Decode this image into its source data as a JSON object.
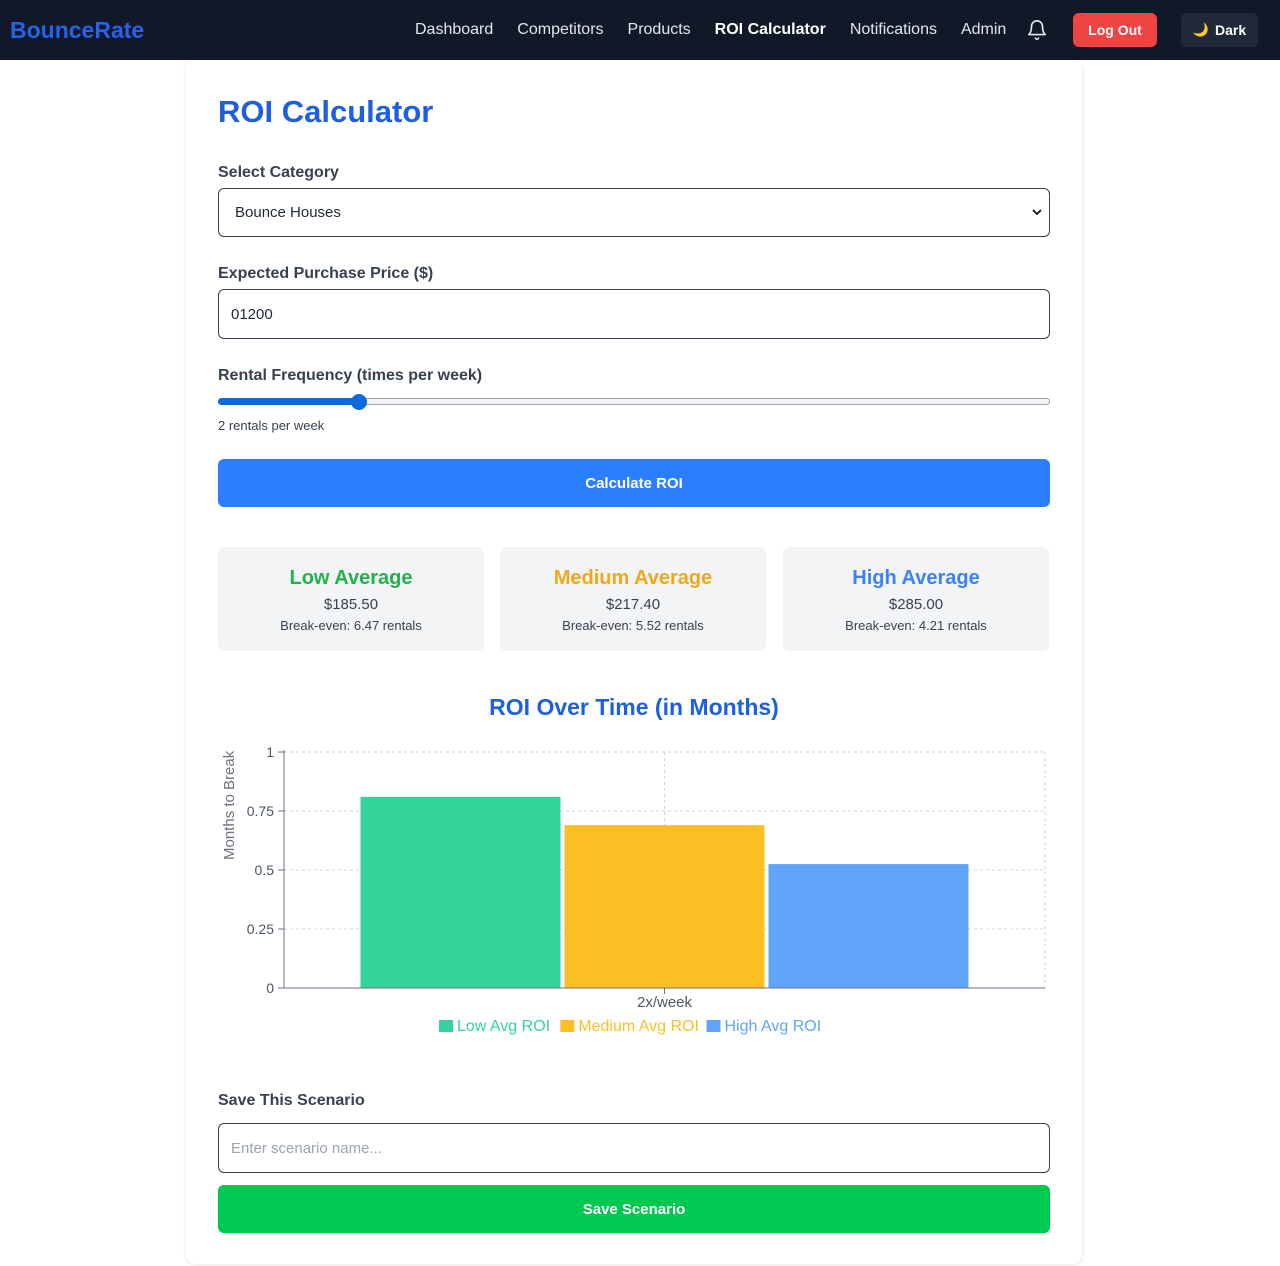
{
  "nav": {
    "brand": "BounceRate",
    "links": [
      "Dashboard",
      "Competitors",
      "Products",
      "ROI Calculator",
      "Notifications",
      "Admin"
    ],
    "logout_label": "Log Out",
    "theme_label": "Dark"
  },
  "page": {
    "title": "ROI Calculator"
  },
  "form": {
    "category_label": "Select Category",
    "category_value": "Bounce Houses",
    "price_label": "Expected Purchase Price ($)",
    "price_value": "01200",
    "frequency_label": "Rental Frequency (times per week)",
    "frequency_text": "2 rentals per week",
    "frequency_fraction": 0.17,
    "calculate_label": "Calculate ROI"
  },
  "stats": [
    {
      "title": "Low Average",
      "value": "$185.50",
      "breakeven": "Break-even: 6.47 rentals",
      "color": "#22b14c"
    },
    {
      "title": "Medium Average",
      "value": "$217.40",
      "breakeven": "Break-even: 5.52 rentals",
      "color": "#f0a818"
    },
    {
      "title": "High Average",
      "value": "$285.00",
      "breakeven": "Break-even: 4.21 rentals",
      "color": "#3b82f6"
    }
  ],
  "chart_data": {
    "type": "bar",
    "title": "ROI Over Time (in Months)",
    "ylabel": "Months to Break",
    "xlabel": "",
    "categories": [
      "2x/week"
    ],
    "series": [
      {
        "name": "Low Avg ROI",
        "values": [
          0.81
        ],
        "color": "#34d399"
      },
      {
        "name": "Medium Avg ROI",
        "values": [
          0.69
        ],
        "color": "#fbbf24"
      },
      {
        "name": "High Avg ROI",
        "values": [
          0.525
        ],
        "color": "#60a5fa"
      }
    ],
    "ylim": [
      0,
      1
    ],
    "yticks": [
      "0",
      "0.25",
      "0.5",
      "0.75",
      "1"
    ],
    "grid": true,
    "legend": "bottom"
  },
  "save": {
    "label": "Save This Scenario",
    "placeholder": "Enter scenario name...",
    "button_label": "Save Scenario"
  }
}
